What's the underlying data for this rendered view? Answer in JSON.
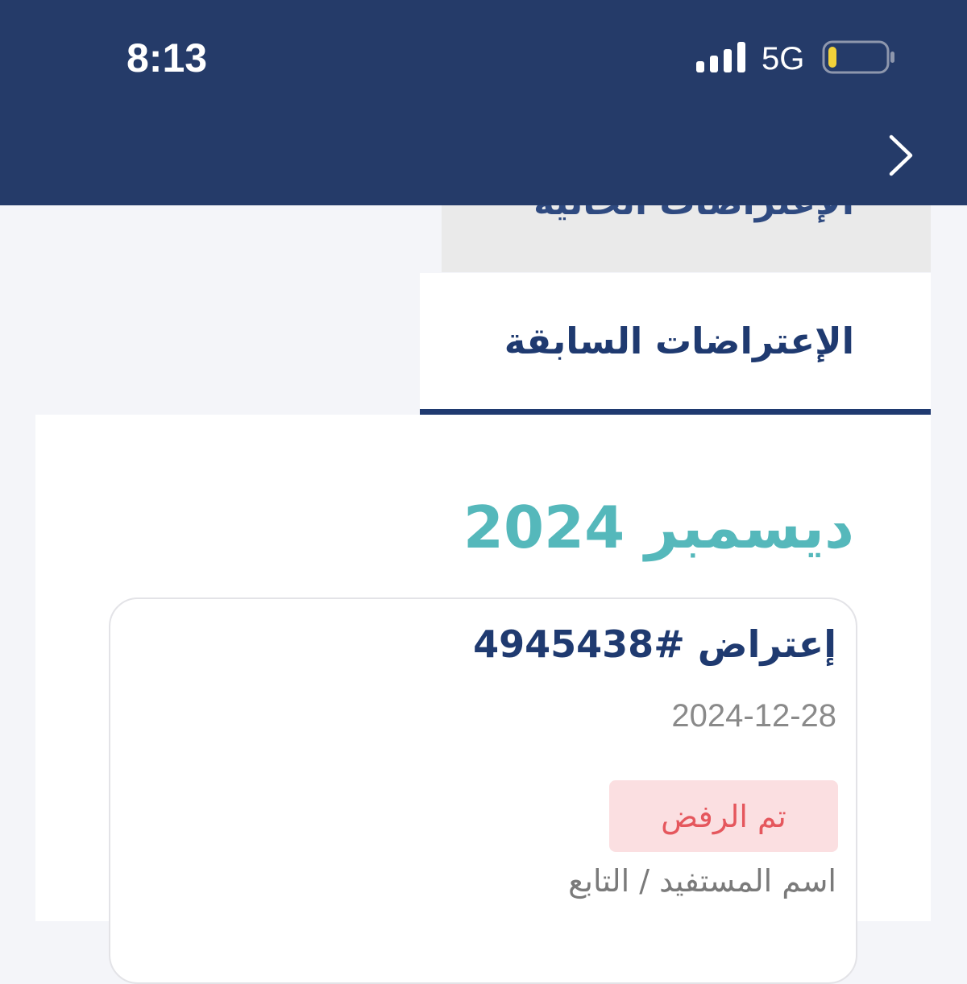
{
  "status_bar": {
    "time": "8:13",
    "network": "5G",
    "icons": {
      "signal": "signal-bars-icon",
      "battery": "battery-low-icon"
    },
    "battery_level": 0.15
  },
  "header": {
    "background_color": "#253b69",
    "back_icon": "chevron-right-icon"
  },
  "tabs": [
    {
      "label": "الإعتراضات الحالية"
    },
    {
      "label": "الإعتراضات السابقة",
      "active": true
    }
  ],
  "content": {
    "month_heading": "ديسمبر 2024",
    "objections": [
      {
        "title": "إعتراض #4945438",
        "date": "2024-12-28",
        "status": "تم الرفض",
        "beneficiary_label": "اسم المستفيد / التابع"
      }
    ]
  },
  "colors": {
    "primary": "#1f3a70",
    "accent": "#55b8bb",
    "rejected_text": "#e5575d",
    "rejected_bg": "#fbdfe1"
  }
}
